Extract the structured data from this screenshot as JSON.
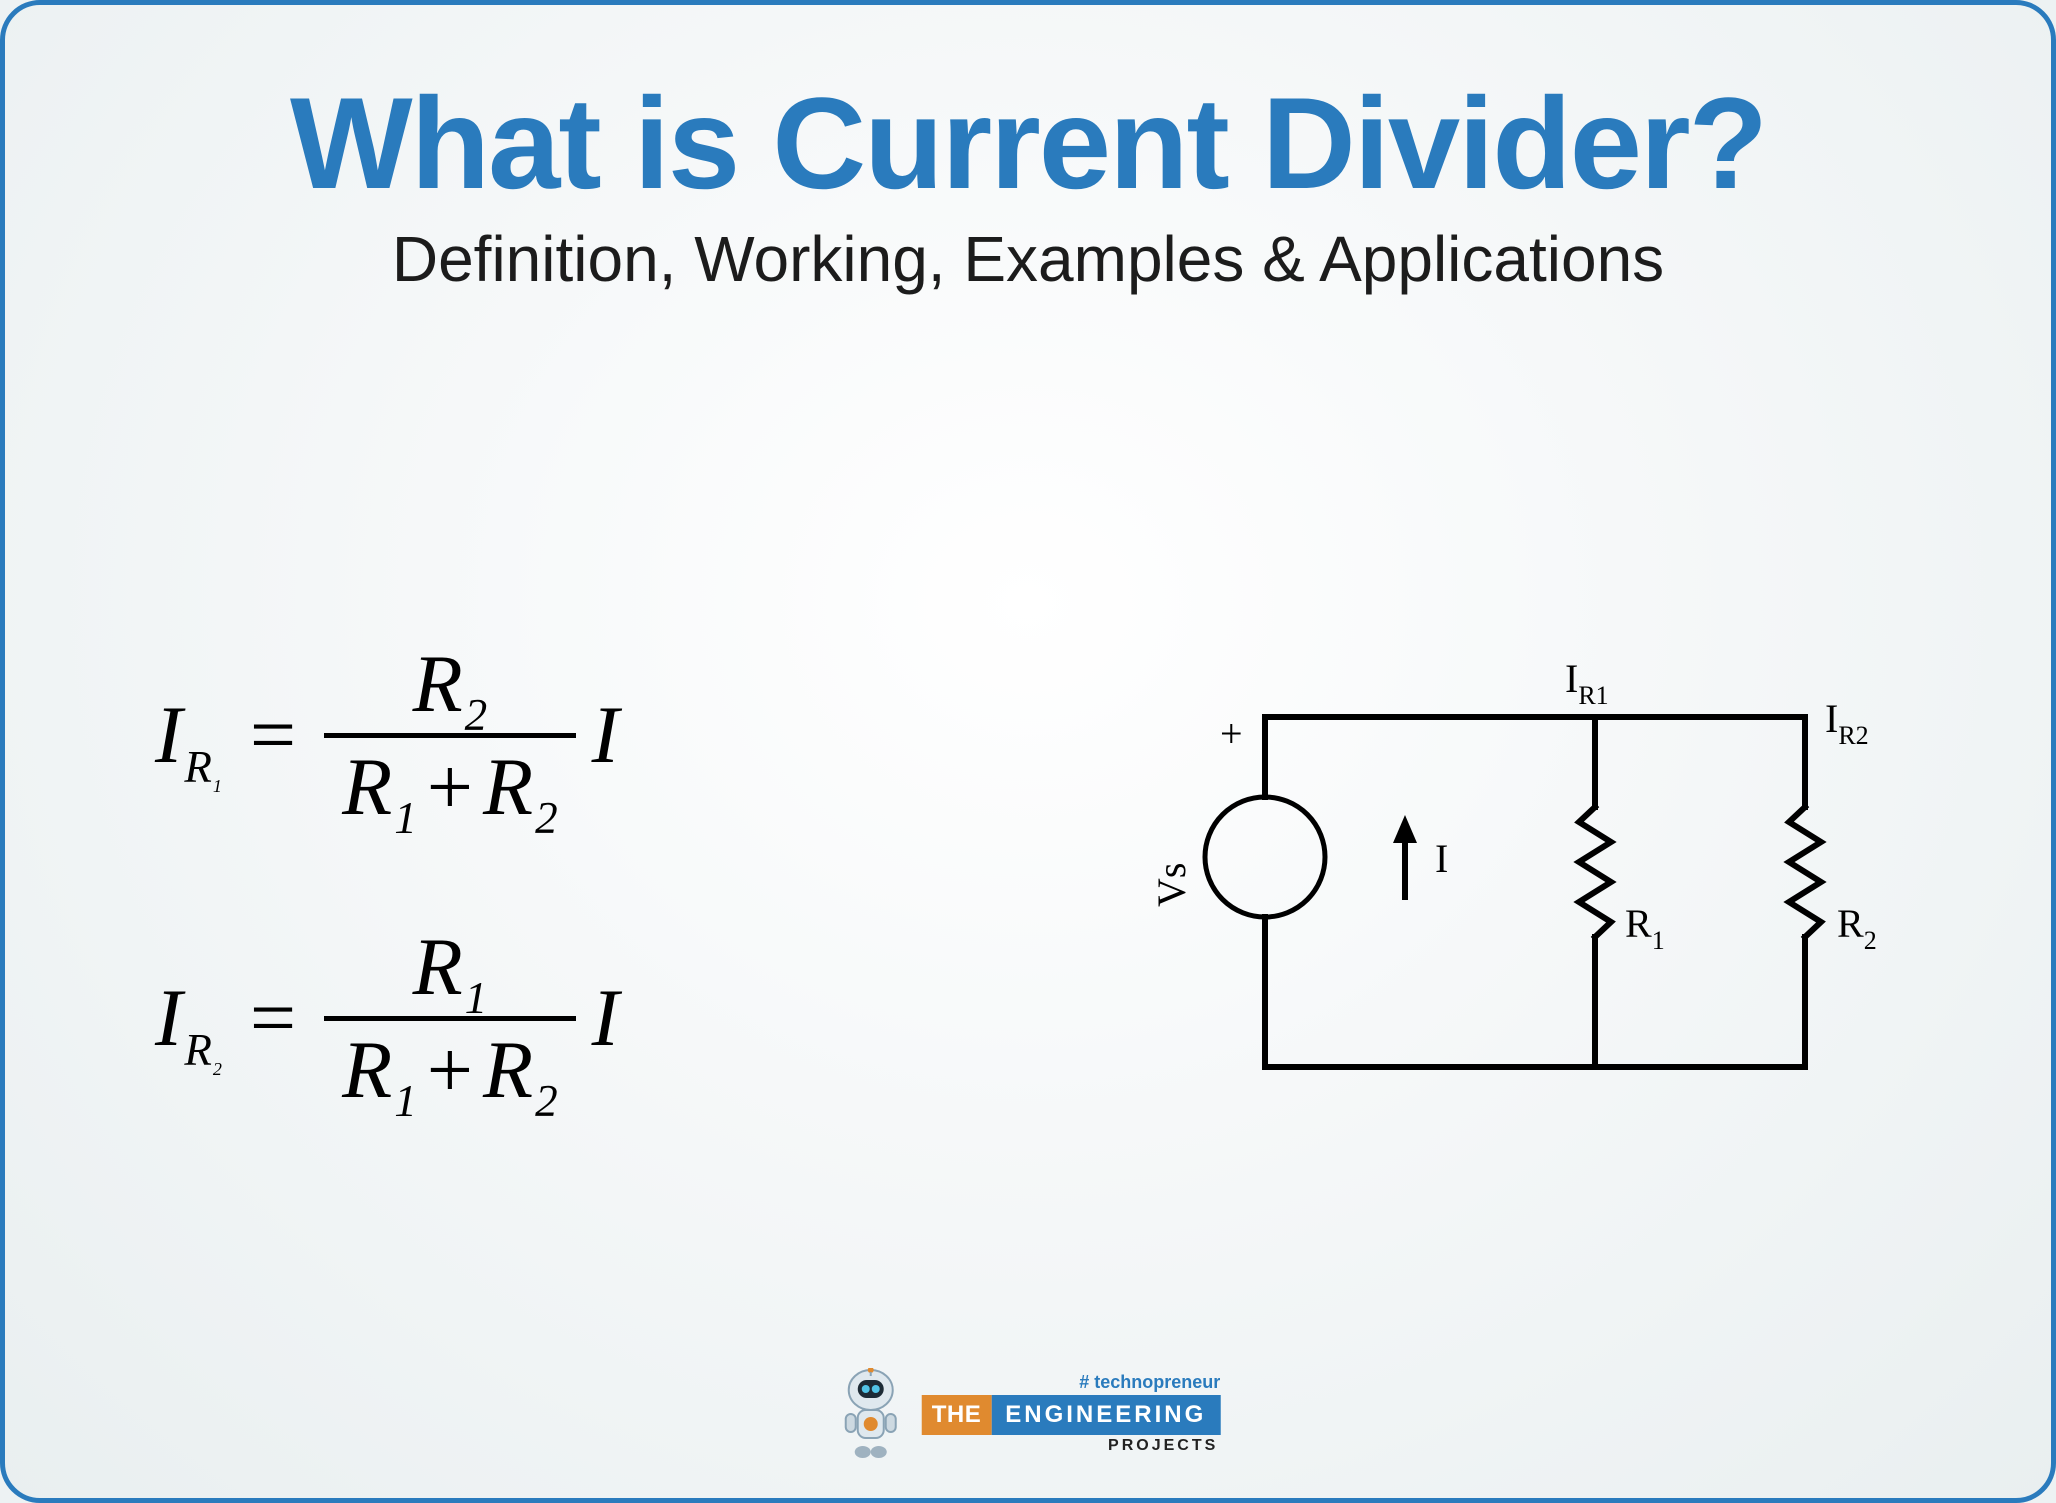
{
  "title": "What is Current Divider?",
  "subtitle": "Definition, Working, Examples & Applications",
  "formulas": {
    "eq1": {
      "lhs_base": "I",
      "lhs_sub_outer": "R",
      "lhs_sub_inner": "1",
      "num_base": "R",
      "num_sub": "2",
      "den_a_base": "R",
      "den_a_sub": "1",
      "plus": "+",
      "den_b_base": "R",
      "den_b_sub": "2",
      "trail": "I",
      "equals": "="
    },
    "eq2": {
      "lhs_base": "I",
      "lhs_sub_outer": "R",
      "lhs_sub_inner": "2",
      "num_base": "R",
      "num_sub": "1",
      "den_a_base": "R",
      "den_a_sub": "1",
      "plus": "+",
      "den_b_base": "R",
      "den_b_sub": "2",
      "trail": "I",
      "equals": "="
    }
  },
  "circuit": {
    "source_plus": "+",
    "source_label": "Vs",
    "total_current": "I",
    "branch1_current": "I",
    "branch1_current_sub": "R1",
    "branch2_current": "I",
    "branch2_current_sub": "R2",
    "r1_base": "R",
    "r1_sub": "1",
    "r2_base": "R",
    "r2_sub": "2"
  },
  "logo": {
    "hashtag": "# technopreneur",
    "word_the": "THE",
    "word_eng": "ENGINEERING",
    "word_proj": "PROJECTS"
  }
}
